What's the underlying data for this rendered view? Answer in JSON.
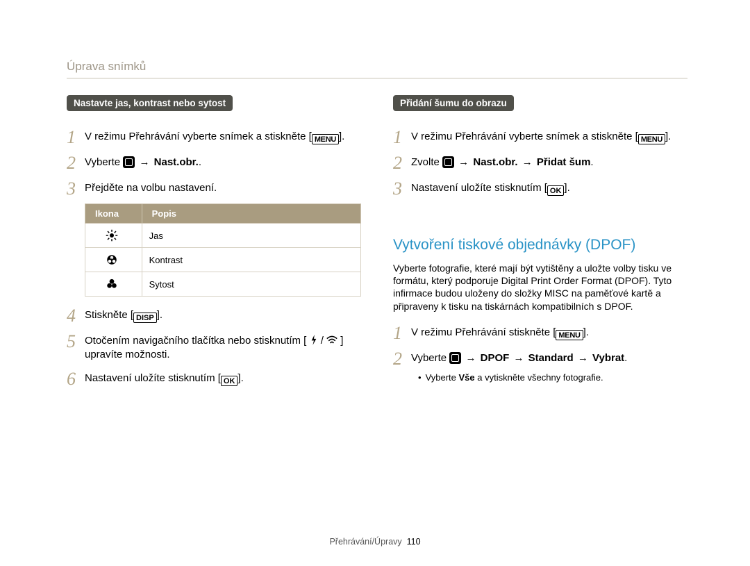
{
  "header": "Úprava snímků",
  "left": {
    "pill": "Nastavte jas, kontrast nebo sytost",
    "step1": {
      "n": "1",
      "prefix": "V režimu Přehrávání vyberte snímek a stiskněte [",
      "menu": "MENU",
      "suffix": "]."
    },
    "step2": {
      "n": "2",
      "prefix": "Vyberte ",
      "arrow": " → ",
      "target": "Nast.obr.",
      "suffix": "."
    },
    "step3": {
      "n": "3",
      "text": "Přejděte na volbu nastavení."
    },
    "table": {
      "h1": "Ikona",
      "h2": "Popis",
      "r1": "Jas",
      "r2": "Kontrast",
      "r3": "Sytost"
    },
    "step4": {
      "n": "4",
      "prefix": "Stiskněte [",
      "disp": "DISP",
      "suffix": "]."
    },
    "step5": {
      "n": "5",
      "prefix": "Otočením navigačního tlačítka nebo stisknutím [",
      "mid": "/",
      "suffix": "] upravíte možnosti."
    },
    "step6": {
      "n": "6",
      "prefix": "Nastavení uložíte stisknutím [",
      "ok": "OK",
      "suffix": "]."
    }
  },
  "right": {
    "pill": "Přidání šumu do obrazu",
    "step1": {
      "n": "1",
      "prefix": "V režimu Přehrávání vyberte snímek a stiskněte [",
      "menu": "MENU",
      "suffix": "]."
    },
    "step2": {
      "n": "2",
      "prefix": "Zvolte ",
      "arrow1": " → ",
      "t1": "Nast.obr.",
      "arrow2": " → ",
      "t2": "Přidat šum",
      "suffix": "."
    },
    "step3": {
      "n": "3",
      "prefix": "Nastavení uložíte stisknutím [",
      "ok": "OK",
      "suffix": "]."
    },
    "section_title": "Vytvoření tiskové objednávky (DPOF)",
    "para": "Vyberte fotografie, které mají být vytištěny a uložte volby tisku ve formátu, který podporuje Digital Print Order Format (DPOF). Tyto infirmace budou uloženy do složky MISC na paměťové kartě a připraveny k tisku na tiskárnách kompatibilních s DPOF.",
    "d_step1": {
      "n": "1",
      "prefix": "V režimu Přehrávání stiskněte [",
      "menu": "MENU",
      "suffix": "]."
    },
    "d_step2": {
      "n": "2",
      "prefix": "Vyberte ",
      "arrow1": " → ",
      "t1": "DPOF",
      "arrow2": " → ",
      "t2": "Standard",
      "arrow3": " → ",
      "t3": "Vybrat",
      "suffix": "."
    },
    "d_bullet": {
      "pre": "Vyberte ",
      "bold": "Vše",
      "post": " a vytiskněte všechny fotografie."
    }
  },
  "footer": {
    "section": "Přehrávání/Úpravy",
    "page": "110"
  }
}
